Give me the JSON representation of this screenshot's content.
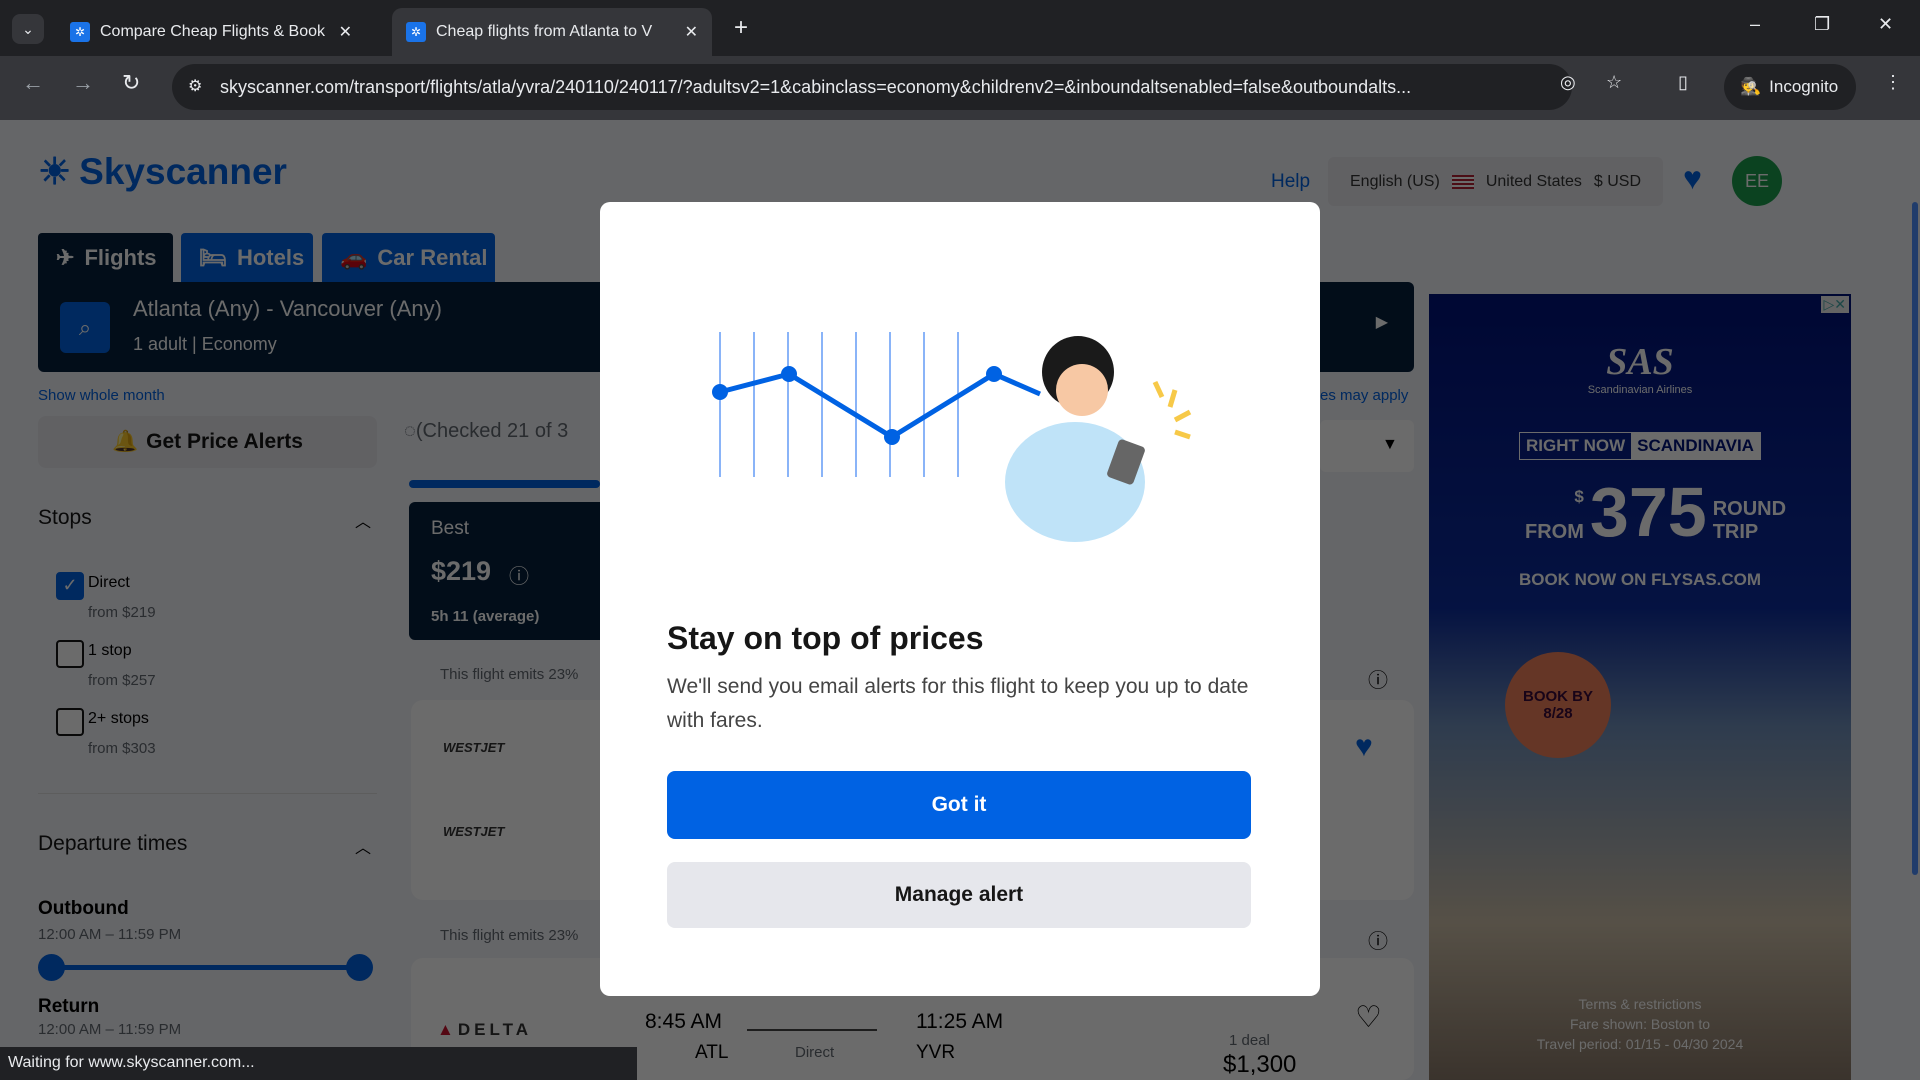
{
  "browser": {
    "tabs": [
      {
        "title": "Compare Cheap Flights & Book"
      },
      {
        "title": "Cheap flights from Atlanta to V"
      }
    ],
    "url": "skyscanner.com/transport/flights/atla/yvra/240110/240117/?adultsv2=1&cabinclass=economy&childrenv2=&inboundaltsenabled=false&outboundalts...",
    "incognito": "Incognito",
    "status": "Waiting for www.skyscanner.com..."
  },
  "header": {
    "logo": "Skyscanner",
    "help": "Help",
    "language": "English (US)",
    "country": "United States",
    "currency": "$ USD",
    "avatar": "EE"
  },
  "nav_tabs": [
    {
      "label": "Flights",
      "icon": "plane-icon"
    },
    {
      "label": "Hotels",
      "icon": "bed-icon"
    },
    {
      "label": "Car Rental",
      "icon": "car-icon"
    }
  ],
  "search": {
    "route": "Atlanta (Any) - Vancouver (Any)",
    "travellers": "1 adult",
    "cabin": "Economy"
  },
  "show_whole_month": "Show whole month",
  "fees_note": "es may apply",
  "price_alerts": "Get Price Alerts",
  "checked": "(Checked 21 of 3",
  "filters": {
    "stops_title": "Stops",
    "stops": [
      {
        "label": "Direct",
        "price": "from $219",
        "checked": true
      },
      {
        "label": "1 stop",
        "price": "from $257",
        "checked": false
      },
      {
        "label": "2+ stops",
        "price": "from $303",
        "checked": false
      }
    ],
    "departure_title": "Departure times",
    "outbound": "Outbound",
    "outbound_range": "12:00 AM – 11:59 PM",
    "return": "Return",
    "return_range": "12:00 AM – 11:59 PM"
  },
  "best": {
    "label": "Best",
    "price": "$219",
    "duration": "5h 11 (average)"
  },
  "results": {
    "emits1": "This flight emits 23%",
    "emits2": "This flight emits 23%",
    "airline1": "WESTJET",
    "airline2": "WESTJET",
    "airline3": "DELTA",
    "depart": "8:45 AM",
    "from": "ATL",
    "arrive": "11:25 AM",
    "to": "YVR",
    "stops": "Direct",
    "deals": "1 deal",
    "price": "$1,300"
  },
  "ad": {
    "brand": "SAS",
    "brand_sub": "Scandinavian Airlines",
    "tag1": "RIGHT NOW",
    "tag2": "SCANDINAVIA",
    "dollar": "$",
    "from": "FROM",
    "price": "375",
    "round": "ROUND",
    "trip": "TRIP",
    "cta": "BOOK NOW ON FLYSAS.COM",
    "badge": "BOOK BY 8/28",
    "terms": "Terms & restrictions",
    "fare": "Fare shown: Boston to",
    "period": "Travel period: 01/15 - 04/30 2024"
  },
  "modal": {
    "title": "Stay on top of prices",
    "body": "We'll send you email alerts for this flight to keep you up to date with fares.",
    "primary": "Got it",
    "secondary": "Manage alert"
  },
  "colors": {
    "brand": "#0062e3",
    "dark": "#05203c"
  }
}
